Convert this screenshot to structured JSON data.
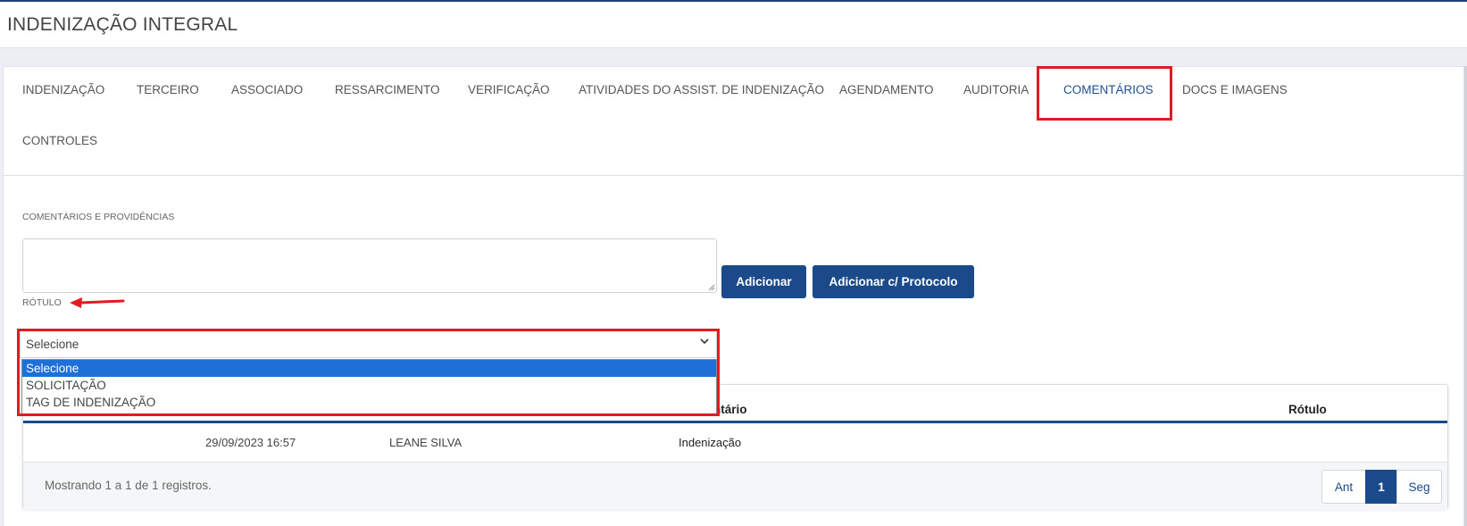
{
  "page": {
    "title": "INDENIZAÇÃO INTEGRAL"
  },
  "tabs": [
    {
      "label": "INDENIZAÇÃO"
    },
    {
      "label": "TERCEIRO"
    },
    {
      "label": "ASSOCIADO"
    },
    {
      "label": "RESSARCIMENTO"
    },
    {
      "label": "VERIFICAÇÃO"
    },
    {
      "label": "ATIVIDADES DO ASSIST. DE INDENIZAÇÃO"
    },
    {
      "label": "AGENDAMENTO"
    },
    {
      "label": "AUDITORIA"
    },
    {
      "label": "COMENTÁRIOS"
    },
    {
      "label": "DOCS E IMAGENS"
    },
    {
      "label": "CONTROLES"
    }
  ],
  "active_tab": "COMENTÁRIOS",
  "form": {
    "comments_label": "COMENTÁRIOS E PROVIDÊNCIAS",
    "comments_value": "",
    "rotulo_label": "RÓTULO",
    "add_button": "Adicionar",
    "add_protocol_button": "Adicionar c/ Protocolo",
    "select": {
      "value": "Selecione",
      "options": [
        "Selecione",
        "SOLICITAÇÃO",
        "TAG DE INDENIZAÇÃO"
      ]
    }
  },
  "table": {
    "headers": {
      "comentario_partial": "ntário",
      "rotulo": "Rótulo"
    },
    "rows": [
      {
        "date": "29/09/2023 16:57",
        "user": "LEANE SILVA",
        "comment": "Indenização",
        "rotulo": ""
      }
    ],
    "footer": "Mostrando 1 a 1 de 1 registros.",
    "pager": {
      "prev": "Ant",
      "current": "1",
      "next": "Seg"
    }
  },
  "colors": {
    "primary": "#1b4a8a",
    "highlight": "#e11b22",
    "selected_option": "#1e6fd6"
  }
}
